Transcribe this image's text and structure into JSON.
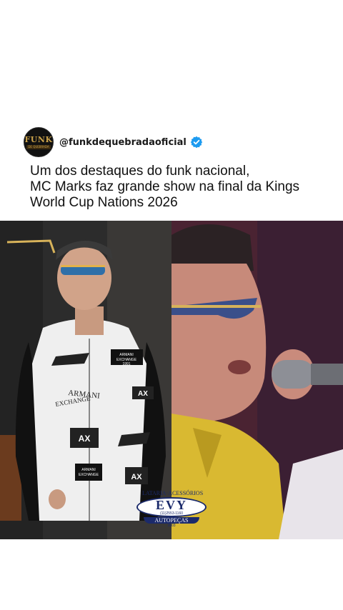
{
  "post": {
    "avatar_text_top": "FUNK",
    "avatar_text_bottom": "DE QUEBRADA",
    "handle": "@funkdequebradaoficial",
    "verified_icon": "verified-badge-icon",
    "caption_lines": [
      "Um dos destaques do funk nacional,",
      "MC Marks faz grande show na final da Kings",
      "World Cup Nations 2026"
    ]
  },
  "images": {
    "left_description_icon": "photo-icon",
    "right_description_icon": "photo-icon"
  },
  "jacket_texts": {
    "armani_exchange": "ARMANI EXCHANGE",
    "badge_1991": "ARMANI EXCHANGE 1991",
    "ax": "AX"
  },
  "sponsor_badge": {
    "top_text": "LATARIA·ACESSÓRIOS",
    "name": "EVY",
    "phone": "(11)2553-1160",
    "bottom_text": "AUTOPEÇAS",
    "year": "2003"
  },
  "colors": {
    "accent_blue": "#1d9bf0",
    "badge_navy": "#1b2a6b",
    "avatar_gold": "#c9a14a"
  }
}
